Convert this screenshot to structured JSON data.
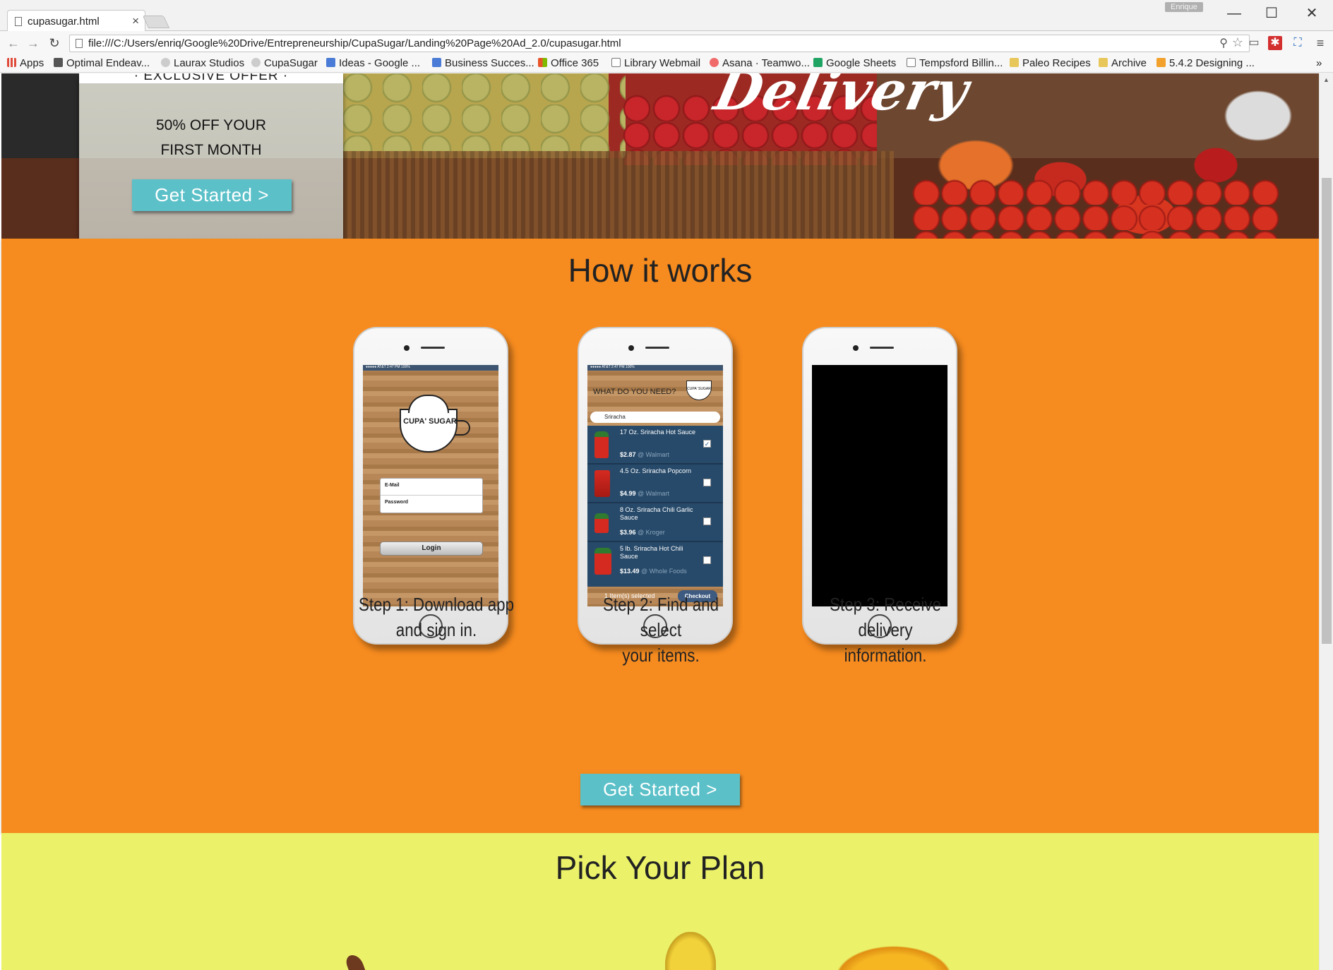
{
  "browser": {
    "tab_title": "cupasugar.html",
    "tab_close": "×",
    "profile_name": "Enrique",
    "url": "file:///C:/Users/enriq/Google%20Drive/Entrepreneurship/CupaSugar/Landing%20Page%20Ad_2.0/cupasugar.html",
    "window_controls": {
      "minimize": "—",
      "maximize": "☐",
      "close": "✕"
    },
    "nav": {
      "back": "←",
      "forward": "→",
      "reload": "↻"
    },
    "bookmarks": [
      {
        "label": "Apps",
        "color": "#e04a3a"
      },
      {
        "label": "Optimal Endeav...",
        "color": "#555555"
      },
      {
        "label": "Laurax Studios",
        "color": "#bbbbbb"
      },
      {
        "label": "CupaSugar",
        "color": "#bbbbbb"
      },
      {
        "label": "Ideas - Google ...",
        "color": "#4a7bd6"
      },
      {
        "label": "Business Succes...",
        "color": "#4a7bd6"
      },
      {
        "label": "Office 365",
        "color": "#e8542a"
      },
      {
        "label": "Library Webmail",
        "color": "#ffffff"
      },
      {
        "label": "Asana · Teamwo...",
        "color": "#f06a6a"
      },
      {
        "label": "Google Sheets",
        "color": "#1fa463"
      },
      {
        "label": "Tempsford Billin...",
        "color": "#ffffff"
      },
      {
        "label": "Paleo Recipes",
        "color": "#e8c75a"
      },
      {
        "label": "Archive",
        "color": "#e8c75a"
      },
      {
        "label": "5.4.2 Designing ...",
        "color": "#f2a12c"
      }
    ],
    "bookmarks_overflow": "»"
  },
  "hero": {
    "delivery_text": "Delivery",
    "offer_header": "· EXCLUSIVE OFFER ·",
    "offer_line1": "50% OFF YOUR",
    "offer_line2": "FIRST MONTH",
    "cta_label": "Get Started >"
  },
  "how": {
    "title": "How it works",
    "steps": [
      {
        "line1": "Step 1: Download app",
        "line2": "and sign in."
      },
      {
        "line1": "Step 2: Find and select",
        "line2": "your items."
      },
      {
        "line1": "Step 3: Receive delivery",
        "line2": "information."
      }
    ],
    "cta_label": "Get Started >"
  },
  "phone1": {
    "status": "●●●●● AT&T    2:47 PM    100%",
    "logo_text": "CUPA' SUGAR",
    "email_label": "E-Mail",
    "password_label": "Password",
    "login_label": "Login"
  },
  "phone2": {
    "status": "●●●●● AT&T    2:47 PM    100%",
    "header_question": "WHAT DO YOU NEED?",
    "logo_text": "CUPA' SUGAR",
    "search_value": "Sriracha",
    "items": [
      {
        "name": "17 Oz. Sriracha Hot Sauce",
        "price": "$2.87",
        "store": "@ Walmart",
        "checked": "✓"
      },
      {
        "name": "4.5 Oz. Sriracha Popcorn",
        "price": "$4.99",
        "store": "@ Walmart",
        "checked": ""
      },
      {
        "name": "8 Oz. Sriracha Chili Garlic Sauce",
        "price": "$3.96",
        "store": "@ Kroger",
        "checked": ""
      },
      {
        "name": "5 lb. Sriracha Hot Chili Sauce",
        "price": "$13.49",
        "store": "@ Whole Foods",
        "checked": ""
      }
    ],
    "selected_text": "1 Item(s) selected",
    "checkout_label": "Checkout"
  },
  "plans": {
    "title": "Pick Your Plan"
  },
  "colors": {
    "orange_section": "#f68b1f",
    "plans_section": "#ebf26a",
    "cta": "#5bc0c8"
  }
}
